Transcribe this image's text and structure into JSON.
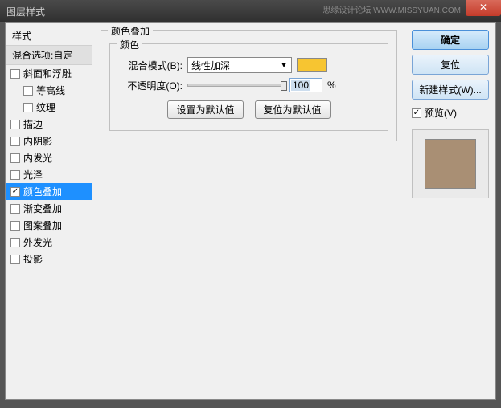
{
  "window": {
    "title": "图层样式",
    "watermark": "思缘设计论坛  WWW.MISSYUAN.COM"
  },
  "sidebar": {
    "header": "样式",
    "sub": "混合选项:自定",
    "items": [
      {
        "label": "斜面和浮雕",
        "checked": false,
        "indent": false
      },
      {
        "label": "等高线",
        "checked": false,
        "indent": true
      },
      {
        "label": "纹理",
        "checked": false,
        "indent": true
      },
      {
        "label": "描边",
        "checked": false,
        "indent": false
      },
      {
        "label": "内阴影",
        "checked": false,
        "indent": false
      },
      {
        "label": "内发光",
        "checked": false,
        "indent": false
      },
      {
        "label": "光泽",
        "checked": false,
        "indent": false
      },
      {
        "label": "颜色叠加",
        "checked": true,
        "indent": false,
        "selected": true
      },
      {
        "label": "渐变叠加",
        "checked": false,
        "indent": false
      },
      {
        "label": "图案叠加",
        "checked": false,
        "indent": false
      },
      {
        "label": "外发光",
        "checked": false,
        "indent": false
      },
      {
        "label": "投影",
        "checked": false,
        "indent": false
      }
    ]
  },
  "panel": {
    "title": "颜色叠加",
    "group": "颜色",
    "blend_label": "混合模式(B):",
    "blend_value": "线性加深",
    "swatch_color": "#f7c531",
    "opacity_label": "不透明度(O):",
    "opacity_value": "100",
    "opacity_suffix": "%",
    "default_btn": "设置为默认值",
    "reset_btn": "复位为默认值"
  },
  "right": {
    "ok": "确定",
    "cancel": "复位",
    "newstyle": "新建样式(W)...",
    "preview_label": "预览(V)",
    "preview_checked": true,
    "preview_swatch": "#a98f74"
  }
}
